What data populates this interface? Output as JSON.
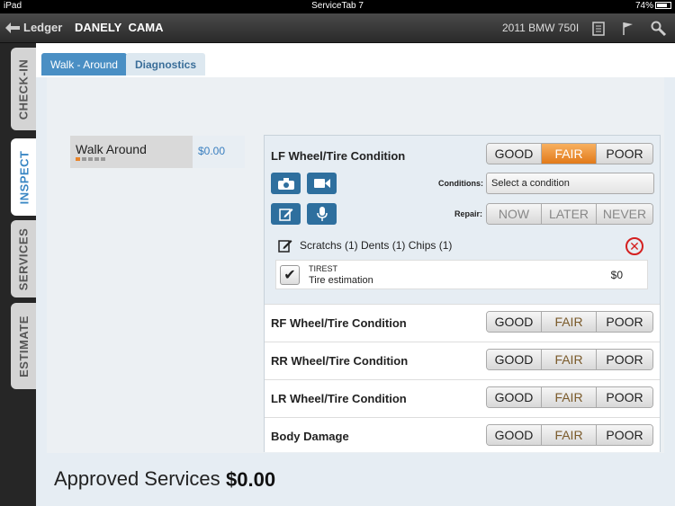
{
  "status_bar": {
    "device": "iPad",
    "app": "ServiceTab 7",
    "battery": "74%"
  },
  "header": {
    "back_label": "Ledger",
    "customer_first": "DANELY",
    "customer_last": "CAMA",
    "vehicle": "2011 BMW 750I"
  },
  "side_nav": [
    {
      "label": "CHECK-IN",
      "active": false
    },
    {
      "label": "INSPECT",
      "active": true
    },
    {
      "label": "SERVICES",
      "active": false
    },
    {
      "label": "ESTIMATE",
      "active": false
    }
  ],
  "tabs": [
    {
      "label": "Walk - Around",
      "active": true
    },
    {
      "label": "Diagnostics",
      "active": false
    }
  ],
  "walk_around": {
    "name": "Walk Around",
    "price": "$0.00",
    "progress": {
      "completed": 1,
      "total": 5
    }
  },
  "inspection": {
    "lf": {
      "title": "LF Wheel/Tire Condition",
      "options": [
        "GOOD",
        "FAIR",
        "POOR"
      ],
      "selected": "FAIR",
      "conditions_label": "Conditions:",
      "conditions_placeholder": "Select a condition",
      "repair_label": "Repair:",
      "repair_options": [
        "NOW",
        "LATER",
        "NEVER"
      ],
      "damage_summary": "Scratchs (1) Dents (1) Chips (1)",
      "service": {
        "code": "TIREST",
        "description": "Tire estimation",
        "amount": "$0"
      }
    },
    "rows": [
      {
        "title": "RF Wheel/Tire Condition",
        "options": [
          "GOOD",
          "FAIR",
          "POOR"
        ]
      },
      {
        "title": "RR Wheel/Tire Condition",
        "options": [
          "GOOD",
          "FAIR",
          "POOR"
        ]
      },
      {
        "title": "LR Wheel/Tire Condition",
        "options": [
          "GOOD",
          "FAIR",
          "POOR"
        ]
      },
      {
        "title": "Body Damage",
        "options": [
          "GOOD",
          "FAIR",
          "POOR"
        ]
      }
    ]
  },
  "footer": {
    "label": "Approved Services",
    "value": "$0.00"
  },
  "colors": {
    "accent": "#3a87c4",
    "selected": "#e27a1a",
    "remove": "#d42020"
  }
}
